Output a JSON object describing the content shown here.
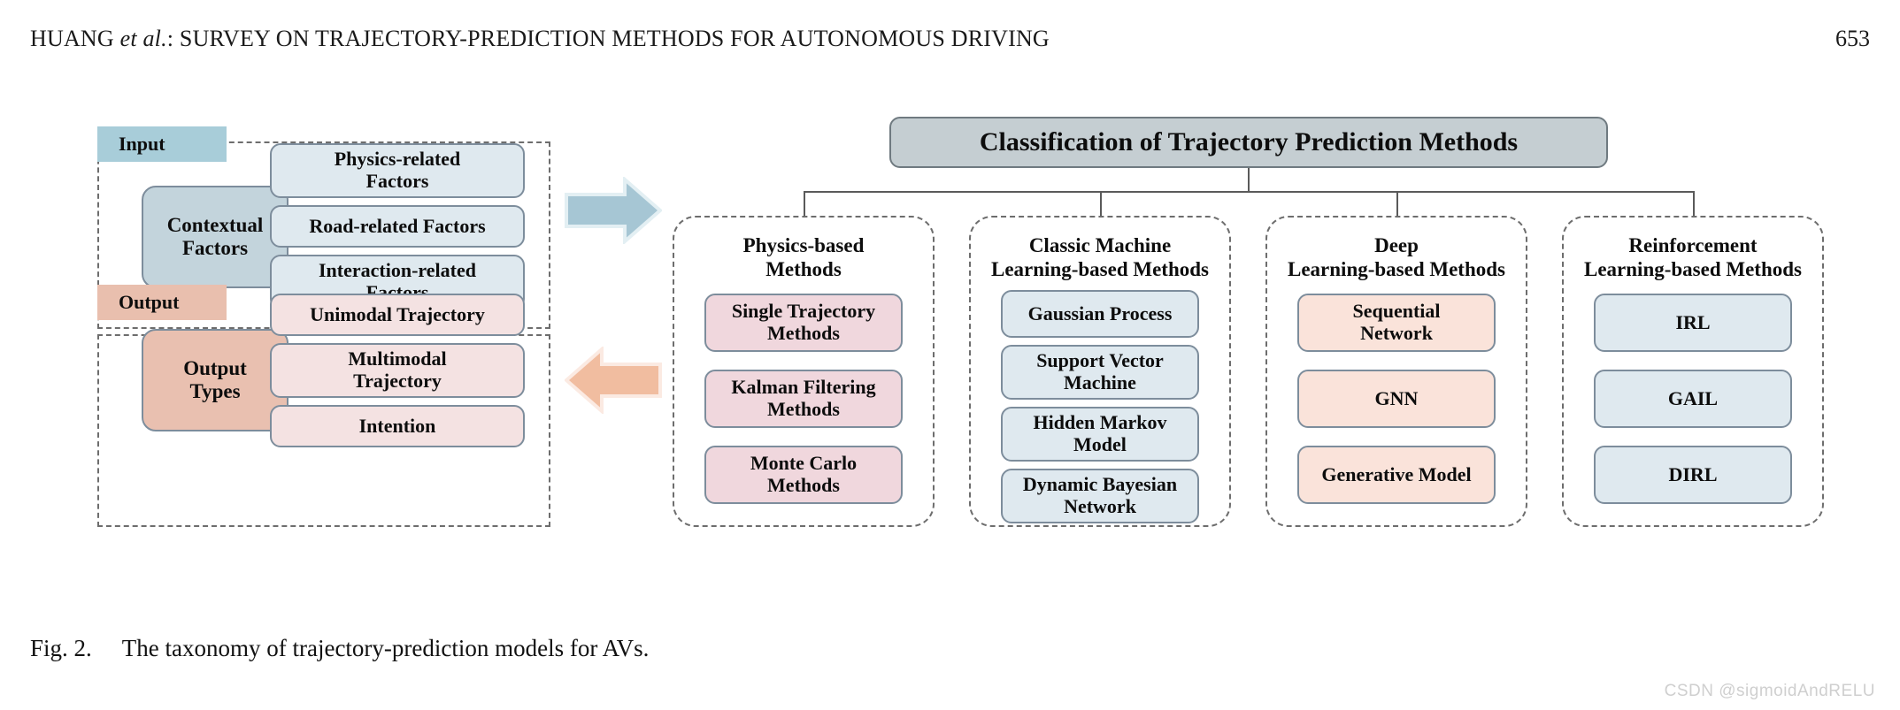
{
  "running_head": {
    "author": "HUANG",
    "etal": "et al.",
    "title": ": SURVEY ON TRAJECTORY-PREDICTION METHODS FOR AUTONOMOUS DRIVING",
    "page_number": "653"
  },
  "caption": {
    "label": "Fig. 2.",
    "text": "The taxonomy of trajectory-prediction models for AVs."
  },
  "watermark": "CSDN @sigmoidAndRELU",
  "colors": {
    "input_badge": "#a8cdd9",
    "output_badge": "#e9bfae",
    "contextual_box": "#c3d4dc",
    "output_types_box": "#e9c0b0",
    "light_blue_box": "#dfe9ef",
    "light_pink_box": "#f4e2e2",
    "pink_box": "#f0d7dd",
    "peach_box": "#fae3da",
    "title_box": "#c5ced2",
    "node_border": "#7d8d9c",
    "dash_border": "#6d6d6d",
    "arrow_blue": "#a6c6d4",
    "arrow_peach": "#f1bda0"
  },
  "io_panel": {
    "input": {
      "badge": "Input",
      "main_node": "Contextual\nFactors",
      "main_node_line1": "Contextual",
      "main_node_line2": "Factors",
      "items": [
        {
          "line1": "Physics-related",
          "line2": "Factors",
          "two_line": true
        },
        {
          "line1": "Road-related Factors",
          "line2": "",
          "two_line": false
        },
        {
          "line1": "Interaction-related",
          "line2": "Factors",
          "two_line": true
        }
      ]
    },
    "output": {
      "badge": "Output",
      "main_node_line1": "Output",
      "main_node_line2": "Types",
      "items": [
        {
          "line1": "Unimodal Trajectory",
          "line2": "",
          "two_line": false
        },
        {
          "line1": "Multimodal",
          "line2": "Trajectory",
          "two_line": true
        },
        {
          "line1": "Intention",
          "line2": "",
          "two_line": false
        }
      ]
    },
    "arrows": {
      "input_arrow": "right-arrow-icon",
      "output_arrow": "left-arrow-icon"
    }
  },
  "taxonomy": {
    "root_title": "Classification of Trajectory Prediction Methods",
    "columns": [
      {
        "title_line1": "Physics-based",
        "title_line2": "Methods",
        "items": [
          {
            "line1": "Single Trajectory",
            "line2": "Methods",
            "two_line": true
          },
          {
            "line1": "Kalman Filtering",
            "line2": "Methods",
            "two_line": true
          },
          {
            "line1": "Monte Carlo",
            "line2": "Methods",
            "two_line": true
          }
        ]
      },
      {
        "title_line1": "Classic Machine",
        "title_line2": "Learning-based Methods",
        "items": [
          {
            "line1": "Gaussian Process",
            "line2": "",
            "two_line": false
          },
          {
            "line1": "Support Vector",
            "line2": "Machine",
            "two_line": true
          },
          {
            "line1": "Hidden Markov",
            "line2": "Model",
            "two_line": true
          },
          {
            "line1": "Dynamic Bayesian",
            "line2": "Network",
            "two_line": true
          }
        ]
      },
      {
        "title_line1": "Deep",
        "title_line2": "Learning-based Methods",
        "items": [
          {
            "line1": "Sequential",
            "line2": "Network",
            "two_line": true
          },
          {
            "line1": "GNN",
            "line2": "",
            "two_line": false
          },
          {
            "line1": "Generative Model",
            "line2": "",
            "two_line": false
          }
        ]
      },
      {
        "title_line1": "Reinforcement",
        "title_line2": "Learning-based Methods",
        "items": [
          {
            "line1": "IRL",
            "line2": "",
            "two_line": false
          },
          {
            "line1": "GAIL",
            "line2": "",
            "two_line": false
          },
          {
            "line1": "DIRL",
            "line2": "",
            "two_line": false
          }
        ]
      }
    ]
  }
}
